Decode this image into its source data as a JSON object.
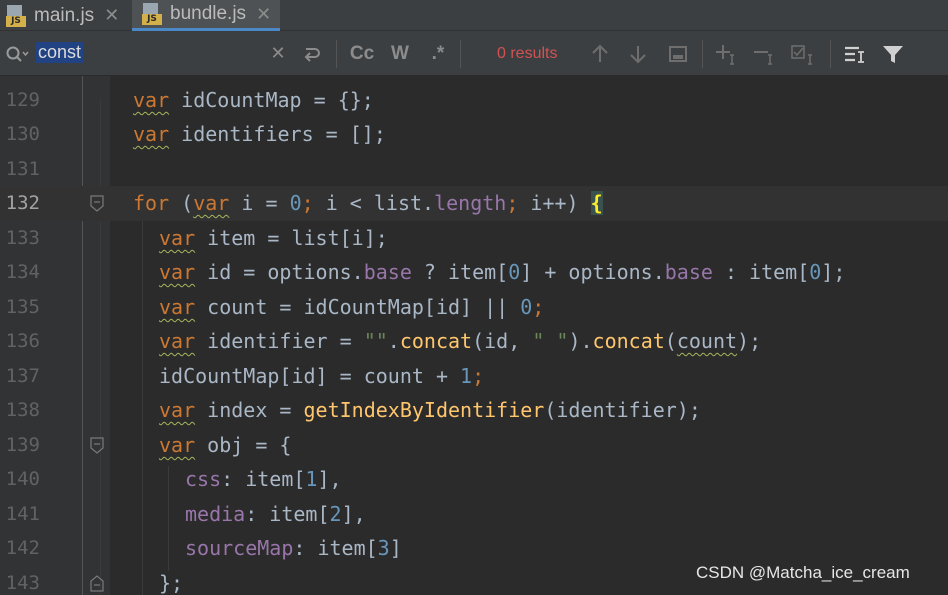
{
  "tabs": [
    {
      "label": "main.js",
      "icon": "js-file-icon",
      "badge": "JS",
      "active": false
    },
    {
      "label": "bundle.js",
      "icon": "js-file-icon",
      "badge": "JS",
      "active": true
    }
  ],
  "search": {
    "query": "const",
    "results_label": "0 results",
    "match_case_label": "Cc",
    "whole_words_label": "W",
    "regex_label": ".*"
  },
  "colors": {
    "background": "#2b2b2b",
    "keyword": "#cc7832",
    "number": "#6897bb",
    "property": "#9876aa",
    "function": "#ffc66d",
    "string": "#6a8759",
    "error": "#d25252"
  },
  "code_lines": [
    {
      "num": "129",
      "current": false,
      "fold": false
    },
    {
      "num": "130",
      "current": false,
      "fold": false
    },
    {
      "num": "131",
      "current": false,
      "fold": false
    },
    {
      "num": "132",
      "current": true,
      "fold": true
    },
    {
      "num": "133",
      "current": false,
      "fold": false
    },
    {
      "num": "134",
      "current": false,
      "fold": false
    },
    {
      "num": "135",
      "current": false,
      "fold": false
    },
    {
      "num": "136",
      "current": false,
      "fold": false
    },
    {
      "num": "137",
      "current": false,
      "fold": false
    },
    {
      "num": "138",
      "current": false,
      "fold": false
    },
    {
      "num": "139",
      "current": false,
      "fold": true
    },
    {
      "num": "140",
      "current": false,
      "fold": false
    },
    {
      "num": "141",
      "current": false,
      "fold": false
    },
    {
      "num": "142",
      "current": false,
      "fold": false
    },
    {
      "num": "143",
      "current": false,
      "fold": true
    }
  ],
  "code": {
    "l129": [
      "var",
      " idCountMap = {};"
    ],
    "l130": [
      "var",
      " identifiers = [];"
    ],
    "l132": [
      "for",
      " (",
      "var",
      " i = ",
      "0",
      "; i < list.",
      "length",
      "; i++) ",
      "{"
    ],
    "l133": [
      "var",
      " item = list[i];"
    ],
    "l134": [
      "var",
      " id = options.",
      "base",
      " ? item[",
      "0",
      "] + options.",
      "base",
      " : item[",
      "0",
      "];"
    ],
    "l135": [
      "var",
      " count = idCountMap[id] || ",
      "0",
      ";"
    ],
    "l136": [
      "var",
      " identifier = ",
      "\"\"",
      ".",
      "concat",
      "(id, ",
      "\" \"",
      ").",
      "concat",
      "(",
      "count",
      ");"
    ],
    "l137": [
      "idCountMap[id] = count + ",
      "1",
      ";"
    ],
    "l138": [
      "var",
      " index = ",
      "getIndexByIdentifier",
      "(identifier);"
    ],
    "l139": [
      "var",
      " obj = {"
    ],
    "l140": [
      "css",
      ": item[",
      "1",
      "],"
    ],
    "l141": [
      "media",
      ": item[",
      "2",
      "],"
    ],
    "l142": [
      "sourceMap",
      ": item[",
      "3",
      "]"
    ],
    "l143": [
      "};"
    ]
  },
  "watermark": "CSDN @Matcha_ice_cream"
}
